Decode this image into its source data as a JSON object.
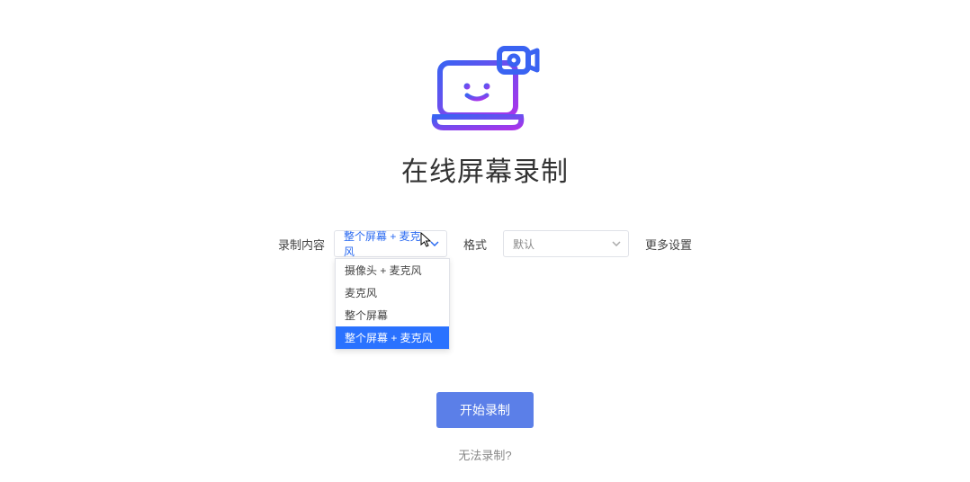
{
  "title": "在线屏幕录制",
  "controls": {
    "content_label": "录制内容",
    "content_value": "整个屏幕 + 麦克风",
    "format_label": "格式",
    "format_value": "默认",
    "more": "更多设置"
  },
  "dropdown": {
    "items": [
      "摄像头 + 麦克风",
      "麦克风",
      "整个屏幕",
      "整个屏幕 + 麦克风"
    ],
    "selected_index": 3
  },
  "start_button": "开始录制",
  "help_link": "无法录制?",
  "colors": {
    "blue": "#2a6af1",
    "purple": "#a032e8",
    "btn": "#5b7fe8"
  }
}
